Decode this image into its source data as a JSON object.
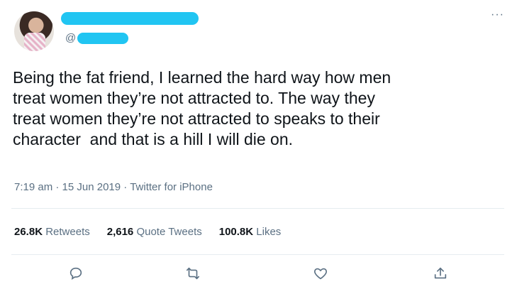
{
  "tweet": {
    "handle_prefix": "@",
    "text": "Being the fat friend, I learned the hard way how men\ntreat women they’re not attracted to. The way they\ntreat women they’re not attracted to speaks to their\ncharacter  and that is a hill I will die on.",
    "time": "7:19 am",
    "date": "15 Jun 2019",
    "client": "Twitter for iPhone",
    "separator": " · "
  },
  "stats": {
    "retweets_value": "26.8K",
    "retweets_label": "Retweets",
    "quotes_value": "2,616",
    "quotes_label": "Quote Tweets",
    "likes_value": "100.8K",
    "likes_label": "Likes"
  },
  "more_label": "···",
  "icons": {
    "reply": "reply-icon",
    "retweet": "retweet-icon",
    "like": "heart-icon",
    "share": "share-icon"
  },
  "colors": {
    "redaction": "#21c5f2",
    "muted": "#5b7083",
    "text": "#0f1419"
  }
}
